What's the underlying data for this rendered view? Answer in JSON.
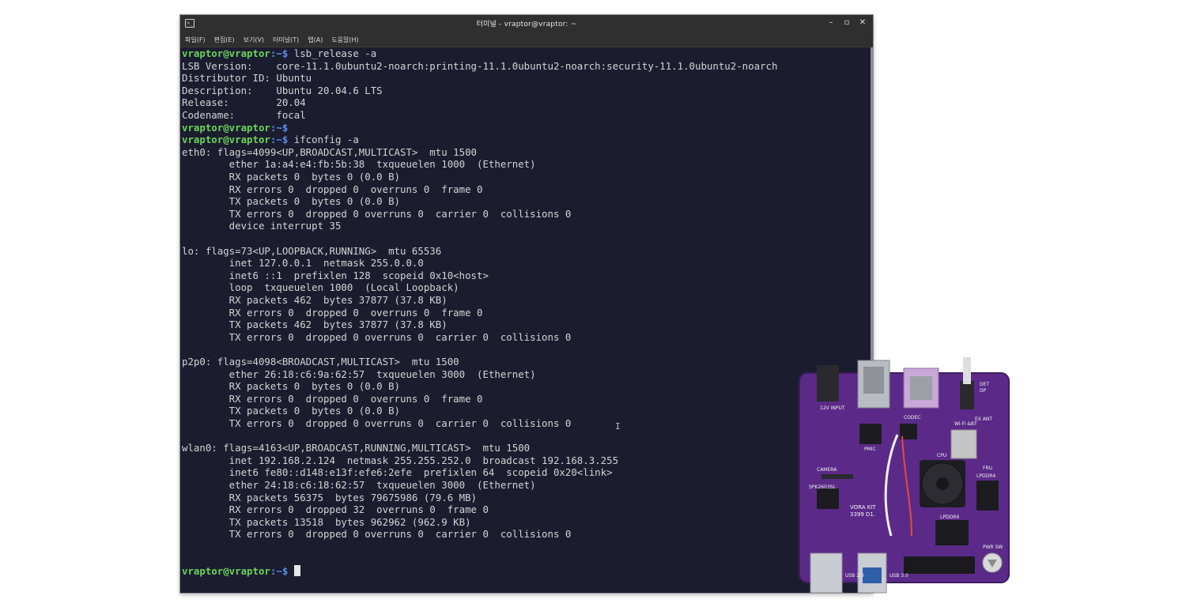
{
  "window": {
    "title": "터미널 - vraptor@vraptor: ~",
    "app_icon": "terminal-icon",
    "controls": [
      "minimize-icon",
      "maximize-icon",
      "close-icon"
    ]
  },
  "menu": [
    "파일(F)",
    "편집(E)",
    "보기(V)",
    "터미널(T)",
    "탭(A)",
    "도움말(H)"
  ],
  "prompt": {
    "user": "vraptor@vraptor",
    "path": ":~$"
  },
  "lines": [
    {
      "type": "prompt",
      "cmd": " lsb_release -a"
    },
    {
      "type": "out",
      "text": "LSB Version:    core-11.1.0ubuntu2-noarch:printing-11.1.0ubuntu2-noarch:security-11.1.0ubuntu2-noarch"
    },
    {
      "type": "out",
      "text": "Distributor ID: Ubuntu"
    },
    {
      "type": "out",
      "text": "Description:    Ubuntu 20.04.6 LTS"
    },
    {
      "type": "out",
      "text": "Release:        20.04"
    },
    {
      "type": "out",
      "text": "Codename:       focal"
    },
    {
      "type": "prompt",
      "cmd": ""
    },
    {
      "type": "prompt",
      "cmd": " ifconfig -a"
    },
    {
      "type": "out",
      "text": "eth0: flags=4099<UP,BROADCAST,MULTICAST>  mtu 1500"
    },
    {
      "type": "out",
      "text": "        ether 1a:a4:e4:fb:5b:38  txqueuelen 1000  (Ethernet)"
    },
    {
      "type": "out",
      "text": "        RX packets 0  bytes 0 (0.0 B)"
    },
    {
      "type": "out",
      "text": "        RX errors 0  dropped 0  overruns 0  frame 0"
    },
    {
      "type": "out",
      "text": "        TX packets 0  bytes 0 (0.0 B)"
    },
    {
      "type": "out",
      "text": "        TX errors 0  dropped 0 overruns 0  carrier 0  collisions 0"
    },
    {
      "type": "out",
      "text": "        device interrupt 35"
    },
    {
      "type": "out",
      "text": ""
    },
    {
      "type": "out",
      "text": "lo: flags=73<UP,LOOPBACK,RUNNING>  mtu 65536"
    },
    {
      "type": "out",
      "text": "        inet 127.0.0.1  netmask 255.0.0.0"
    },
    {
      "type": "out",
      "text": "        inet6 ::1  prefixlen 128  scopeid 0x10<host>"
    },
    {
      "type": "out",
      "text": "        loop  txqueuelen 1000  (Local Loopback)"
    },
    {
      "type": "out",
      "text": "        RX packets 462  bytes 37877 (37.8 KB)"
    },
    {
      "type": "out",
      "text": "        RX errors 0  dropped 0  overruns 0  frame 0"
    },
    {
      "type": "out",
      "text": "        TX packets 462  bytes 37877 (37.8 KB)"
    },
    {
      "type": "out",
      "text": "        TX errors 0  dropped 0 overruns 0  carrier 0  collisions 0"
    },
    {
      "type": "out",
      "text": ""
    },
    {
      "type": "out",
      "text": "p2p0: flags=4098<BROADCAST,MULTICAST>  mtu 1500"
    },
    {
      "type": "out",
      "text": "        ether 26:18:c6:9a:62:57  txqueuelen 3000  (Ethernet)"
    },
    {
      "type": "out",
      "text": "        RX packets 0  bytes 0 (0.0 B)"
    },
    {
      "type": "out",
      "text": "        RX errors 0  dropped 0  overruns 0  frame 0"
    },
    {
      "type": "out",
      "text": "        TX packets 0  bytes 0 (0.0 B)"
    },
    {
      "type": "out",
      "text": "        TX errors 0  dropped 0 overruns 0  carrier 0  collisions 0"
    },
    {
      "type": "out",
      "text": ""
    },
    {
      "type": "out",
      "text": "wlan0: flags=4163<UP,BROADCAST,RUNNING,MULTICAST>  mtu 1500"
    },
    {
      "type": "out",
      "text": "        inet 192.168.2.124  netmask 255.255.252.0  broadcast 192.168.3.255"
    },
    {
      "type": "out",
      "text": "        inet6 fe80::d148:e13f:efe6:2efe  prefixlen 64  scopeid 0x20<link>"
    },
    {
      "type": "out",
      "text": "        ether 24:18:c6:18:62:57  txqueuelen 3000  (Ethernet)"
    },
    {
      "type": "out",
      "text": "        RX packets 56375  bytes 79675986 (79.6 MB)"
    },
    {
      "type": "out",
      "text": "        RX errors 0  dropped 32  overruns 0  frame 0"
    },
    {
      "type": "out",
      "text": "        TX packets 13518  bytes 962962 (962.9 KB)"
    },
    {
      "type": "out",
      "text": "        TX errors 0  dropped 0 overruns 0  carrier 0  collisions 0"
    },
    {
      "type": "out",
      "text": ""
    },
    {
      "type": "out",
      "text": ""
    },
    {
      "type": "prompt",
      "cmd": " ",
      "cursor": true
    }
  ],
  "colors": {
    "terminal_bg": "#1b1d2f",
    "terminal_fg": "#d3d3d3",
    "prompt_user": "#6cd35a",
    "prompt_path": "#5c8fe8",
    "pcb": "#5b2a88"
  },
  "board": {
    "image": "vora-kit-3399-board-photo",
    "labels": {
      "input": "12V INPUT",
      "codec": "CODEC",
      "wifi": "Wi-Fi &BT",
      "ex_ant": "EX ANT",
      "cpu": "CPU",
      "camera": "CAMERA",
      "pmic": "PMIC",
      "spk": "SPK2603SL",
      "lpddr4_a": "LPDDR4",
      "lpddr4_b": "LPDDR4",
      "fru": "FRU",
      "brand": "VORA KIT",
      "model": "3399 D1.",
      "usb2": "USB 2.0",
      "usb3": "USB 3.0",
      "pwr": "PWR SW",
      "det": "DET",
      "dp": "DP"
    }
  }
}
